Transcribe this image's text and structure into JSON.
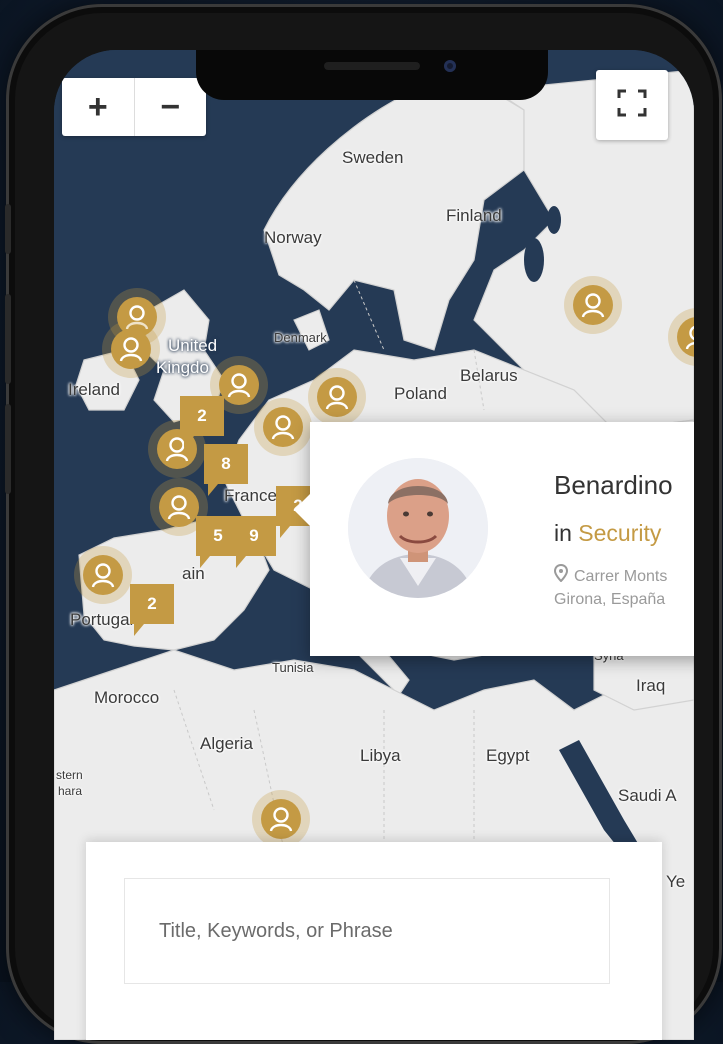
{
  "map": {
    "zoom_in_label": "+",
    "zoom_out_label": "−",
    "fullscreen_icon": "fullscreen-icon",
    "colors": {
      "sea": "#253a55",
      "land": "#ececec",
      "accent": "#c49a44"
    },
    "labels": {
      "sweden": "Sweden",
      "finland": "Finland",
      "norway": "Norway",
      "united": "United",
      "kingdom": "Kingdo",
      "denmark": "Denmark",
      "ireland": "Ireland",
      "poland": "Poland",
      "belarus": "Belarus",
      "france": "France",
      "spain": "ain",
      "portugal": "Portugal",
      "tunisia": "Tunisia",
      "morocco": "Morocco",
      "algeria": "Algeria",
      "libya": "Libya",
      "egypt": "Egypt",
      "syria": "Syria",
      "iraq": "Iraq",
      "saudi": "Saudi A",
      "western": "stern",
      "sahara": "hara",
      "yemen": "Ye"
    },
    "clusters": {
      "c1": "2",
      "c2": "8",
      "c3": "5",
      "c4": "9",
      "c5": "2",
      "c6": "2"
    }
  },
  "popup": {
    "name": "Benardino",
    "in_text": "in ",
    "category": "Security",
    "address_line1": "Carrer Monts",
    "address_line2": "Girona, España",
    "pin_icon": "location-pin-icon"
  },
  "search": {
    "placeholder": "Title, Keywords, or Phrase",
    "value": ""
  }
}
